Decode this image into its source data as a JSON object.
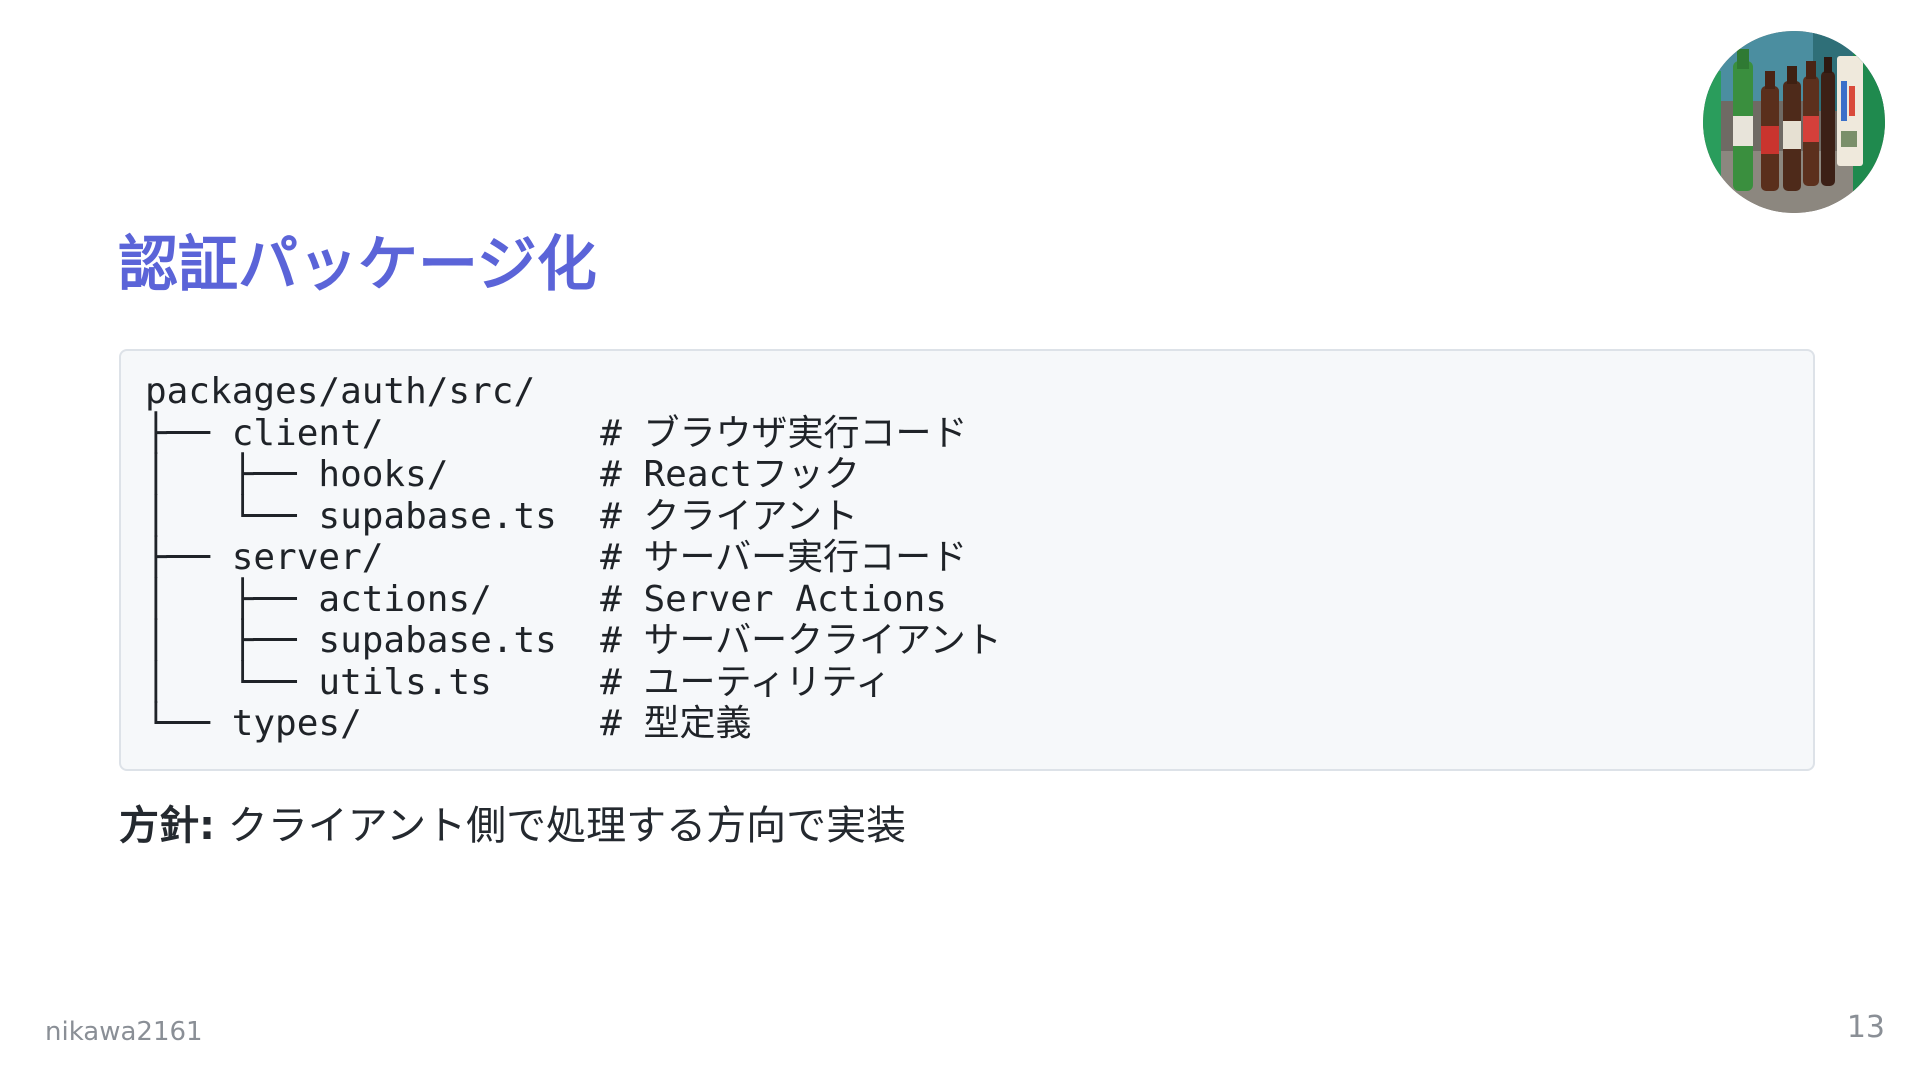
{
  "slide": {
    "title": "認証パッケージ化",
    "avatar_icon": "profile-photo-bottles",
    "code_lines": [
      "packages/auth/src/",
      "├── client/          # ブラウザ実行コード",
      "│   ├── hooks/       # Reactフック",
      "│   └── supabase.ts  # クライアント",
      "├── server/          # サーバー実行コード",
      "│   ├── actions/     # Server Actions",
      "│   ├── supabase.ts  # サーバークライアント",
      "│   └── utils.ts     # ユーティリティ",
      "└── types/           # 型定義"
    ],
    "note_label": "方針",
    "note_separator": ":",
    "note_text": " クライアント側で処理する方向で実装",
    "author": "nikawa2161",
    "page_number": "13"
  },
  "colors": {
    "title": "#5b64d8",
    "code_background": "#f6f8fa",
    "code_border": "#dde2e8",
    "footer_text": "#8a8f96"
  }
}
